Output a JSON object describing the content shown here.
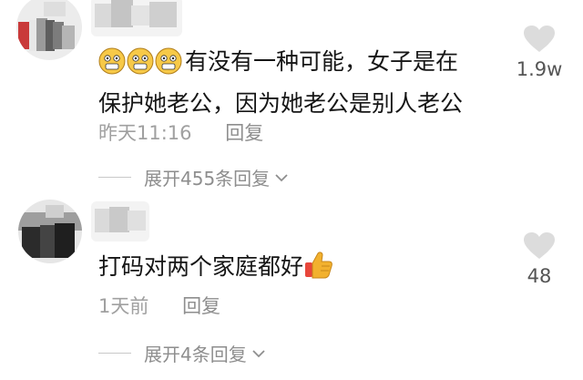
{
  "comments": [
    {
      "text_line1": "有没有一种可能，女子是在",
      "text_line2": "保护她老公，因为她老公是别人老公",
      "time": "昨天11:16",
      "reply": "回复",
      "expand": "展开455条回复",
      "like_count": "1.9w",
      "emoji_prefix": [
        "grinning-face-emoji",
        "grinning-face-emoji",
        "grinning-face-emoji"
      ]
    },
    {
      "text": "打码对两个家庭都好",
      "emoji_suffix": "thumbs-up-emoji",
      "time": "1天前",
      "reply": "回复",
      "expand": "展开4条回复",
      "like_count": "48"
    }
  ],
  "colors": {
    "meta": "#a0a0a0",
    "heart": "#dcdcdc",
    "emoji_yellow": "#f7c948",
    "thumb": "#f2b12e",
    "cuff": "#e8463b"
  }
}
